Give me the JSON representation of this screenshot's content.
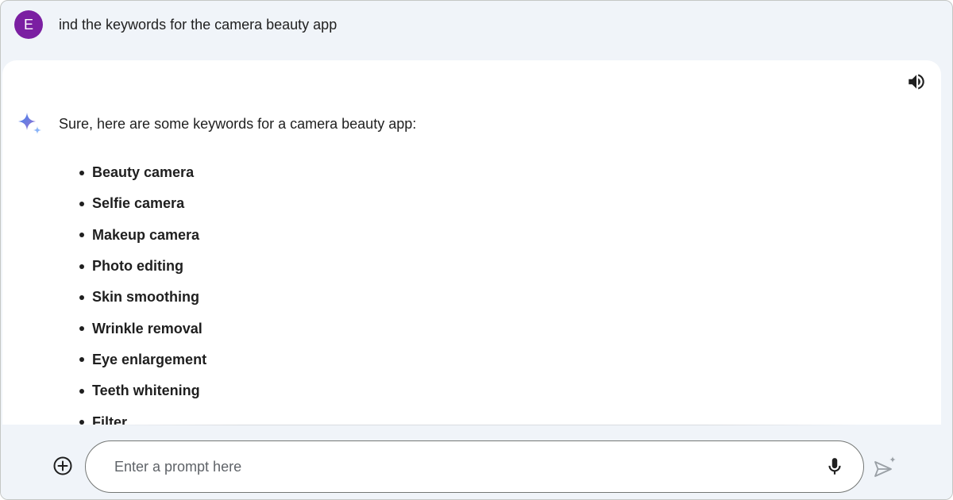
{
  "user_message": {
    "avatar_letter": "E",
    "text": "ind the keywords for the camera beauty app"
  },
  "response": {
    "intro": "Sure, here are some keywords for a camera beauty app:",
    "keywords": [
      "Beauty camera",
      "Selfie camera",
      "Makeup camera",
      "Photo editing",
      "Skin smoothing",
      "Wrinkle removal",
      "Eye enlargement",
      "Teeth whitening",
      "Filter"
    ]
  },
  "input": {
    "placeholder": "Enter a prompt here",
    "value": ""
  },
  "icons": {
    "avatar": "avatar",
    "speaker": "volume-icon",
    "assistant": "gemini-sparkle-icon",
    "add": "add-circle-icon",
    "mic": "mic-icon",
    "send": "send-icon"
  },
  "colors": {
    "avatar_bg": "#7b1fa2",
    "background": "#f0f4f9",
    "text": "#1f1f1f",
    "sparkle": "#4285f4"
  }
}
